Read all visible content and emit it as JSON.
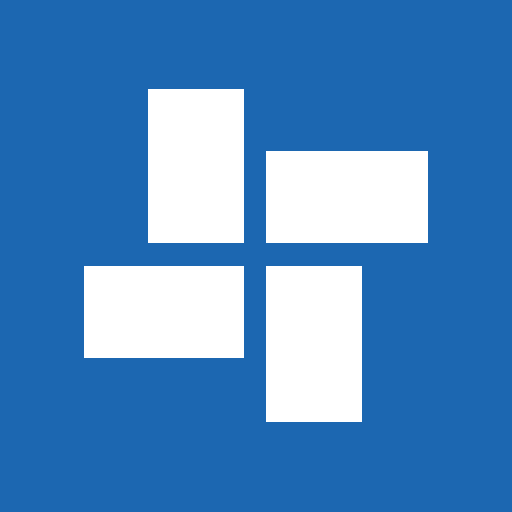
{
  "logo": {
    "icon": "pinwheel-tiles-icon",
    "background_color": "#1C67B1",
    "tile_color": "#FFFFFF"
  }
}
